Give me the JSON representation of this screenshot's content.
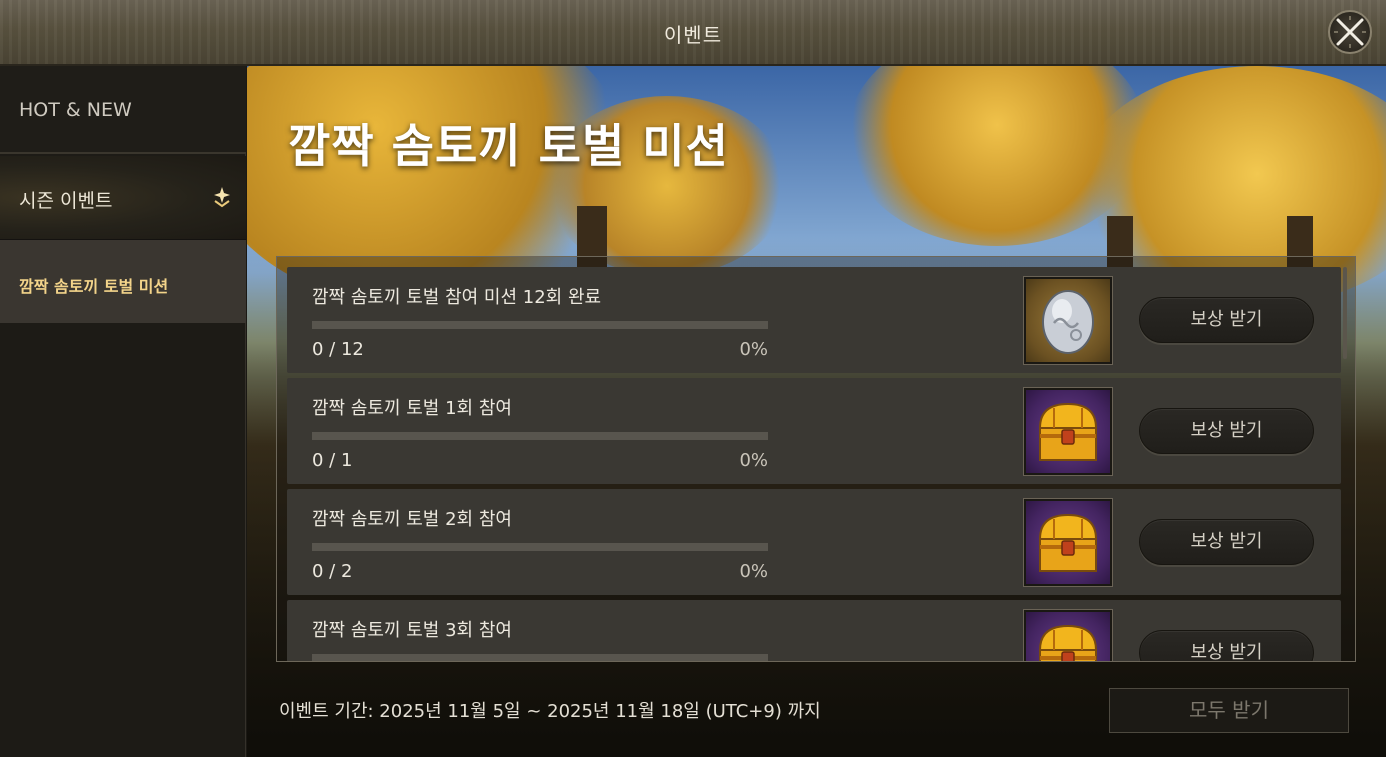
{
  "window": {
    "title": "이벤트"
  },
  "sidebar": {
    "items": [
      {
        "label": "HOT & NEW"
      },
      {
        "label": "시즌 이벤트"
      },
      {
        "label": "깜짝 솜토끼 토벌 미션"
      }
    ]
  },
  "event": {
    "title": "깜짝 솜토끼 토벌 미션",
    "missions": [
      {
        "title": "깜짝 솜토끼 토벌 참여 미션 12회 완료",
        "count": "0 / 12",
        "percent": "0%",
        "progress": 0,
        "reward_icon": "egg-icon",
        "button": "보상 받기"
      },
      {
        "title": "깜짝 솜토끼 토벌 1회 참여",
        "count": "0 / 1",
        "percent": "0%",
        "progress": 0,
        "reward_icon": "treasure-chest-icon",
        "button": "보상 받기"
      },
      {
        "title": "깜짝 솜토끼 토벌 2회 참여",
        "count": "0 / 2",
        "percent": "0%",
        "progress": 0,
        "reward_icon": "treasure-chest-icon",
        "button": "보상 받기"
      },
      {
        "title": "깜짝 솜토끼 토벌 3회 참여",
        "count": "",
        "percent": "",
        "progress": 0,
        "reward_icon": "treasure-chest-icon",
        "button": "보상 받기"
      }
    ],
    "period": "이벤트 기간: 2025년 11월 5일 ~ 2025년 11월 18일 (UTC+9) 까지",
    "claim_all": "모두 받기"
  },
  "colors": {
    "accent_gold": "#f3d48a",
    "panel_row": "#3a3833",
    "progress_track": "#58554e"
  }
}
